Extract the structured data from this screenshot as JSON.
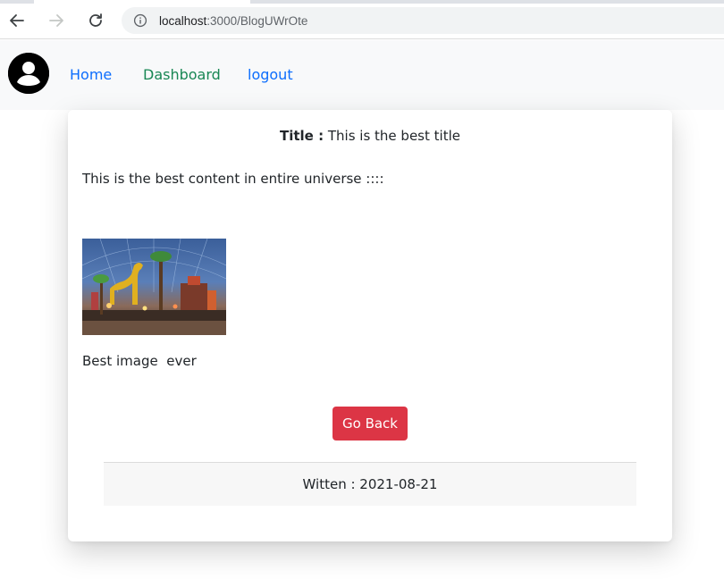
{
  "browser": {
    "url_host": "localhost",
    "url_path": ":3000/BlogUWrOte"
  },
  "nav": {
    "home": "Home",
    "dashboard": "Dashboard",
    "logout": "logout"
  },
  "post": {
    "title_label": "Title :",
    "title_value": "This is the best title",
    "content": "This is the best content in entire universe ::::",
    "caption": "Best image  ever",
    "go_back": "Go Back",
    "written": "Witten : 2021-08-21"
  },
  "colors": {
    "home_link": "#0d6efd",
    "dashboard_link": "#198754",
    "logout_link": "#0d6efd",
    "go_back_button": "#dc3545"
  }
}
